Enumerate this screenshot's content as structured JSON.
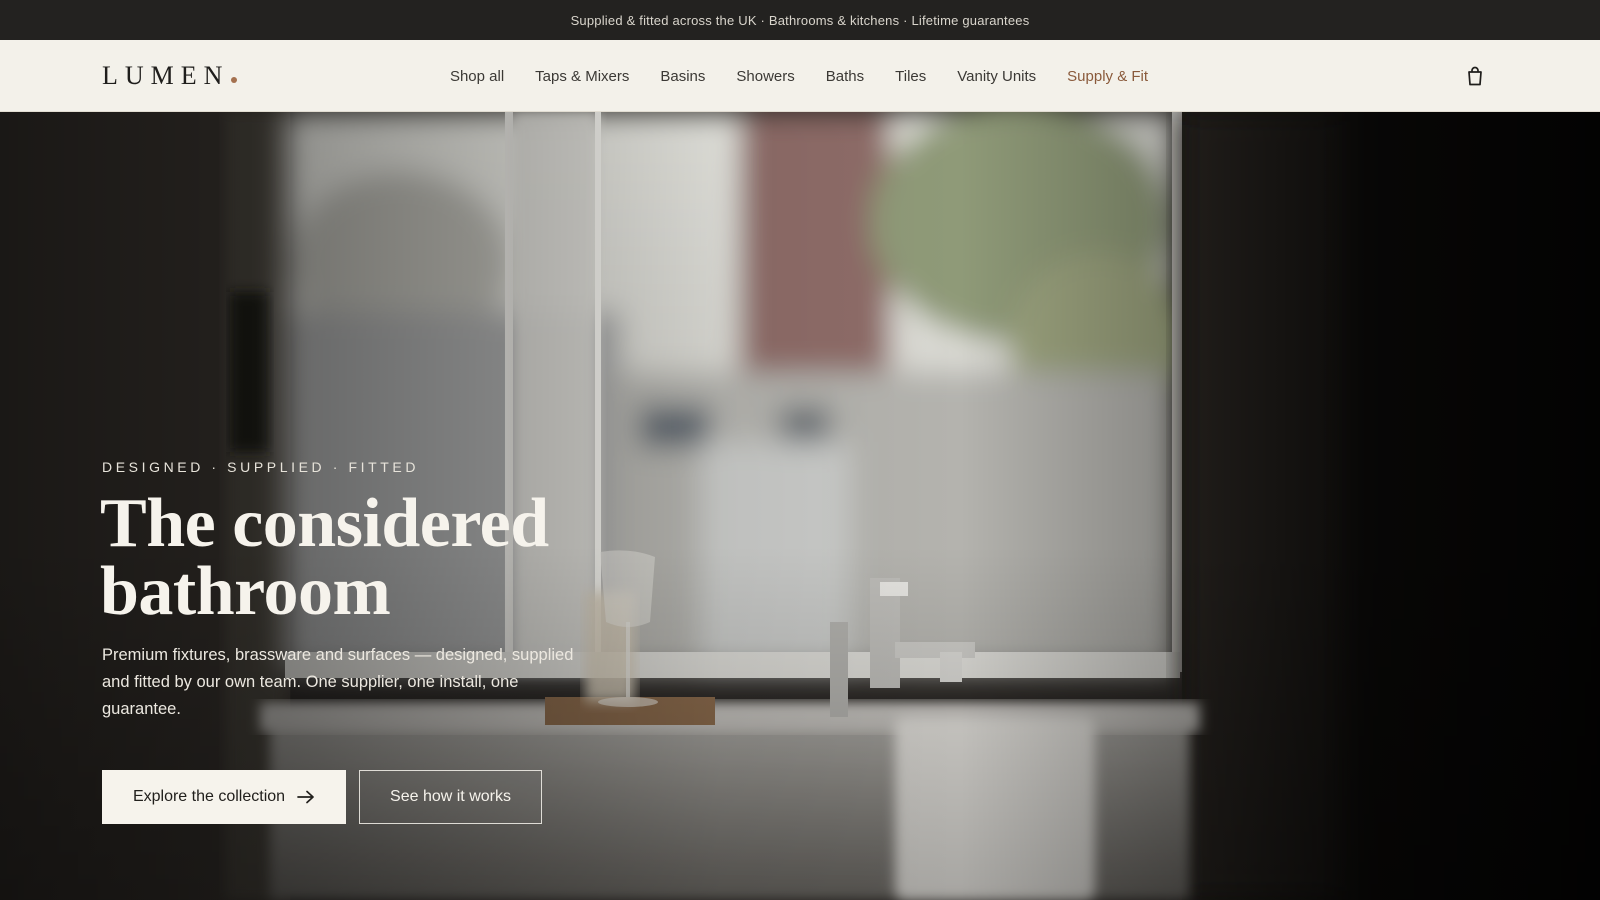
{
  "announcement": "Supplied & fitted across the UK · Bathrooms & kitchens · Lifetime guarantees",
  "brand": {
    "name": "LUMEN",
    "dot_color": "#a4714f"
  },
  "nav": {
    "items": [
      {
        "label": "Shop all"
      },
      {
        "label": "Taps & Mixers"
      },
      {
        "label": "Basins"
      },
      {
        "label": "Showers"
      },
      {
        "label": "Baths"
      },
      {
        "label": "Tiles"
      },
      {
        "label": "Vanity Units"
      },
      {
        "label": "Supply & Fit",
        "accent": true
      }
    ],
    "cart_icon": "shopping-bag-icon"
  },
  "hero": {
    "eyebrow": "DESIGNED · SUPPLIED · FITTED",
    "headline": "The considered bathroom",
    "subtext": "Premium fixtures, brassware and surfaces — designed, supplied and fitted by our own team. One supplier, one install, one guarantee.",
    "primary_cta": "Explore the collection",
    "primary_cta_icon": "arrow-right-icon",
    "secondary_cta": "See how it works",
    "image": "bathroom window with freestanding bath, mixer tap, glass and towel"
  },
  "colors": {
    "topbar_bg": "#232220",
    "header_bg": "#f3f1ea",
    "accent": "#8a5a3b",
    "button_light": "#f6f3ec"
  }
}
